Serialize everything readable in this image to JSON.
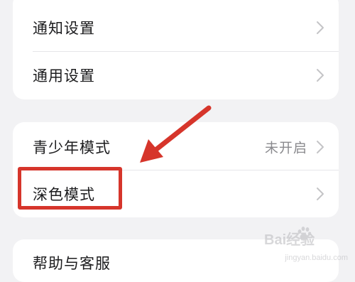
{
  "groups": [
    {
      "items": [
        {
          "label": "通知设置"
        },
        {
          "label": "通用设置"
        }
      ]
    },
    {
      "items": [
        {
          "label": "青少年模式",
          "value": "未开启"
        },
        {
          "label": "深色模式"
        }
      ]
    },
    {
      "items": [
        {
          "label": "帮助与客服"
        }
      ]
    }
  ],
  "annotation": {
    "color": "#d6352b",
    "target": "深色模式"
  },
  "watermark": {
    "brand": "Bai经验",
    "sub": "jingyan.baidu.com"
  },
  "colors": {
    "background": "#f2f2f4",
    "card": "#ffffff",
    "text": "#1c1c1e",
    "secondary_text": "#8a8a8e",
    "chevron": "#c4c4c7"
  },
  "icons": [
    "chevron-right-icon",
    "annotation-arrow-icon",
    "baidu-paw-icon"
  ]
}
